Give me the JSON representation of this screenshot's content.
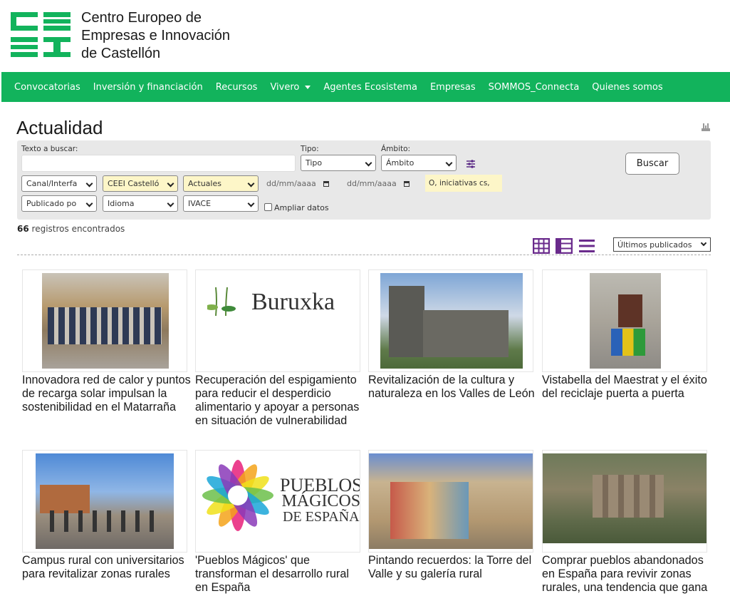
{
  "header": {
    "org_name_line1": "Centro Europeo de",
    "org_name_line2": "Empresas e Innovación",
    "org_name_line3": "de Castellón",
    "brand_color": "#12b35c"
  },
  "nav": {
    "items": [
      {
        "label": "Convocatorias"
      },
      {
        "label": "Inversión y financiación"
      },
      {
        "label": "Recursos"
      },
      {
        "label": "Vivero"
      },
      {
        "label": "Agentes Ecosistema"
      },
      {
        "label": "Empresas"
      },
      {
        "label": "SOMMOS_Connecta"
      },
      {
        "label": "Quienes somos"
      }
    ]
  },
  "page": {
    "title": "Actualidad"
  },
  "filters": {
    "text_label": "Texto a buscar:",
    "tipo_label": "Tipo:",
    "tipo_value": "Tipo",
    "ambito_label": "Ámbito:",
    "ambito_value": "Ámbito",
    "search_button": "Buscar",
    "canal_value": "Canal/Interfa",
    "ceei_value": "CEEI Castelló",
    "actuales_value": "Actuales",
    "date_from_placeholder": "dd/mm/aaaa",
    "date_to_placeholder": "dd/mm/aaaa",
    "tags_value": "O, iniciativas cs,",
    "publicado_value": "Publicado po",
    "idioma_value": "Idioma",
    "ivace_value": "IVACE",
    "ampliar_label": "Ampliar datos"
  },
  "results": {
    "count": "66",
    "count_suffix": "registros encontrados",
    "sort_value": "Últimos publicados"
  },
  "cards": [
    {
      "title": "Innovadora red de calor y puntos de recarga solar impulsan la sostenibilidad en el Matarraña"
    },
    {
      "title": "Recuperación del espigamiento para reducir el desperdicio alimentario y apoyar a personas en situación de vulnerabilidad",
      "logo_text": "Buruxka"
    },
    {
      "title": "Revitalización de la cultura y naturaleza en los Valles de León"
    },
    {
      "title": "Vistabella del Maestrat y el éxito del reciclaje puerta a puerta"
    },
    {
      "title": "Campus rural con universitarios para revitalizar zonas rurales"
    },
    {
      "title": "'Pueblos Mágicos' que transforman el desarrollo rural en España",
      "logo_line1": "PUEBLOS",
      "logo_line2": "MÁGICOS",
      "logo_line3": "DE ESPAÑA"
    },
    {
      "title": "Pintando recuerdos: la Torre del Valle y su galería rural"
    },
    {
      "title": "Comprar pueblos abandonados en España para revivir zonas rurales, una tendencia que gana"
    }
  ]
}
